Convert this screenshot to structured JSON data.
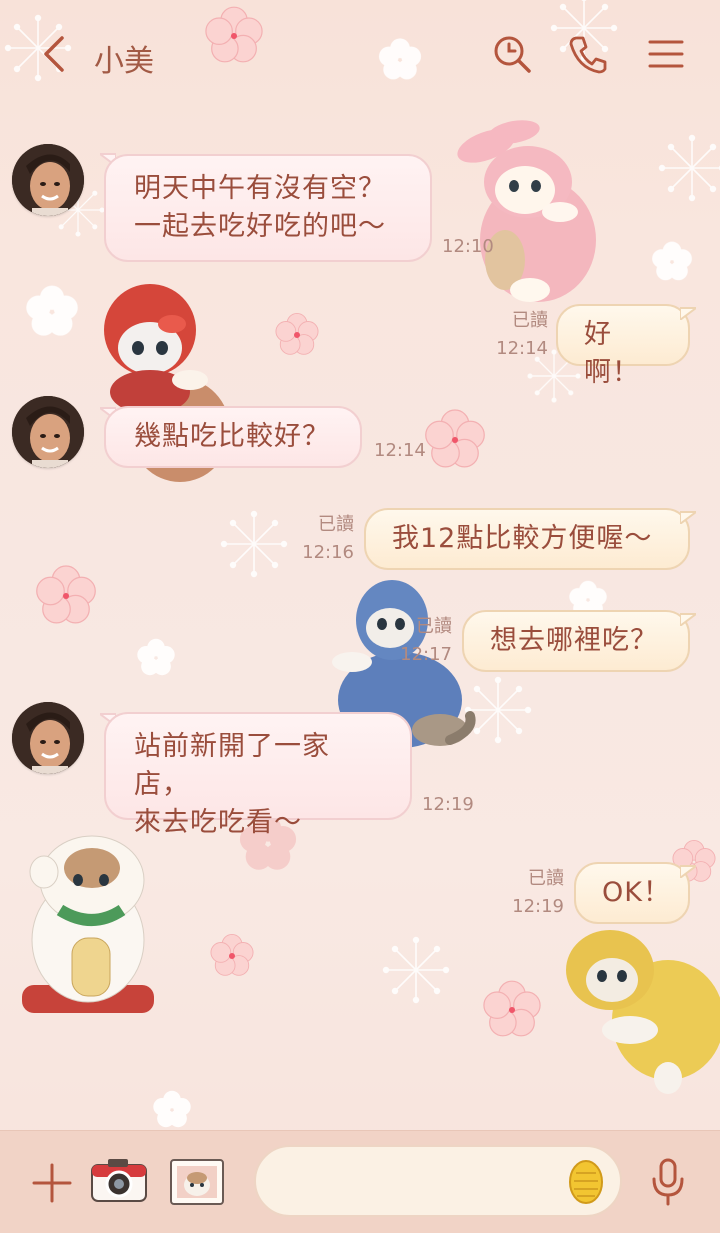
{
  "header": {
    "title": "小美"
  },
  "messages": [
    {
      "side": "left",
      "lines": [
        "明天中午有沒有空？",
        "一起去吃好吃的吧〜"
      ],
      "time": "12:10"
    },
    {
      "side": "right",
      "lines": [
        "好啊！"
      ],
      "read": "已讀",
      "time": "12:14"
    },
    {
      "side": "left",
      "lines": [
        "幾點吃比較好？"
      ],
      "time": "12:14"
    },
    {
      "side": "right",
      "lines": [
        "我12點比較方便喔〜"
      ],
      "read": "已讀",
      "time": "12:16"
    },
    {
      "side": "right",
      "lines": [
        "想去哪裡吃？"
      ],
      "read": "已讀",
      "time": "12:17"
    },
    {
      "side": "left",
      "lines": [
        "站前新開了一家店，",
        "來去吃吃看〜"
      ],
      "time": "12:19"
    },
    {
      "side": "right",
      "lines": [
        "OK！"
      ],
      "read": "已讀",
      "time": "12:19"
    }
  ],
  "icons": {
    "back": "chevron-left-icon",
    "search": "search-icon",
    "call": "phone-icon",
    "menu": "hamburger-menu-icon",
    "add": "plus-icon",
    "camera": "camera-icon",
    "photo": "photo-icon",
    "emoji": "emoji-icon",
    "mic": "microphone-icon"
  },
  "colors": {
    "accent": "#b4553d",
    "left_bubble": "#fdeaea",
    "right_bubble": "#fdf0dc",
    "text": "#9a4d3c",
    "bottom_bar": "#f1d3c6"
  }
}
